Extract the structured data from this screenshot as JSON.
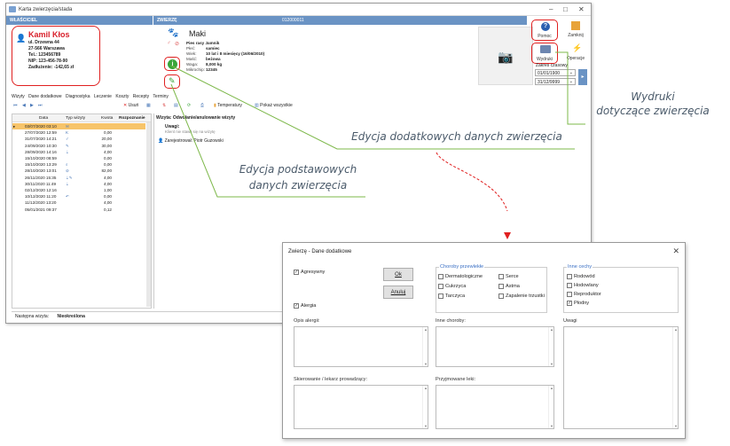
{
  "window": {
    "title": "Karta zwierzęcia/stada"
  },
  "owner_header": "WŁAŚCICIEL",
  "animal_header": "ZWIERZĘ",
  "animal_id": "012000011",
  "owner": {
    "name": "Kamil Kłos",
    "street": "ul. Drzewna 44",
    "city": "27-566  Warszawa",
    "phone": "Tel.: 123456789",
    "nip": "NIP: 123-456-78-90",
    "debt": "Zadłużenie: -142,65 zł"
  },
  "animal": {
    "name": "Maki",
    "rows": [
      {
        "k": "Pies rasy",
        "v": "Jamnik"
      },
      {
        "k": "Płeć:",
        "v": "samiec"
      },
      {
        "k": "Wiek:",
        "v": "10 lat i 8 miesięcy (16/06/2010)"
      },
      {
        "k": "Maść:",
        "v": "beżowa"
      },
      {
        "k": "Waga:",
        "v": "8,000 kg"
      },
      {
        "k": "Mikrochip:",
        "v": "12345"
      }
    ]
  },
  "right_buttons": {
    "help": "Pomoc",
    "close": "Zamknij",
    "prints": "Wydruki",
    "operations": "Operacje"
  },
  "date_range": {
    "label": "Zakres czasowy",
    "from": "01/01/1900",
    "to": "31/12/9999"
  },
  "tabs": [
    "Wizyty",
    "Dane dodatkowe",
    "Diagnostyka",
    "Leczenie",
    "Koszty",
    "Recepty",
    "Terminy"
  ],
  "toolbar": {
    "delete": "Usuń",
    "settle": "Rozpoznanie",
    "temperature": "Temperatury",
    "show_all": "Pokaż wszystkie"
  },
  "grid": {
    "cols": [
      "Data",
      "Typ wizyty",
      "Kwota"
    ],
    "rows": [
      {
        "date": "03/07/2020 03:10",
        "amount": ""
      },
      {
        "date": "27/07/2020 12:59",
        "amount": "0,00"
      },
      {
        "date": "31/07/2020 14:21",
        "amount": "20,00"
      },
      {
        "date": "24/09/2020 10:30",
        "amount": "30,00"
      },
      {
        "date": "28/09/2020 14:16",
        "amount": "4,00"
      },
      {
        "date": "15/10/2020 08:59",
        "amount": "0,00"
      },
      {
        "date": "15/10/2020 13:29",
        "amount": "0,00"
      },
      {
        "date": "28/10/2020 13:01",
        "amount": "82,00"
      },
      {
        "date": "26/11/2020 15:35",
        "amount": "4,00"
      },
      {
        "date": "30/11/2020 11:49",
        "amount": "4,00"
      },
      {
        "date": "02/12/2020 12:16",
        "amount": "1,00"
      },
      {
        "date": "10/12/2020 11:20",
        "amount": "0,00"
      },
      {
        "date": "11/12/2020 13:20",
        "amount": "4,00"
      },
      {
        "date": "05/01/2021 09:37",
        "amount": "0,12"
      }
    ]
  },
  "visit": {
    "title": "Wizyta: Odwołanie/anulowanie wizyty",
    "notes_label": "Uwagi:",
    "notes_text": "Klient nie stawił się na wizytę",
    "registered": "Zarejestrował: Piotr Guzowski"
  },
  "status": {
    "label": "Następna wizyta:",
    "value": "Nieokreślona"
  },
  "callouts": {
    "prints": "Wydruki\ndotyczące zwierzęcia",
    "additional": "Edycja dodatkowych danych zwierzęcia",
    "basic": "Edycja podstawowych\ndanych zwierzęcia"
  },
  "dialog": {
    "title": "Zwierzę - Dane dodatkowe",
    "aggressive": "Agresywny",
    "ok": "Ok",
    "cancel": "Anuluj",
    "allergy": "Alergia",
    "chronic_label": "Choroby przewlekłe",
    "chronic": [
      "Dermatologiczne",
      "Serce",
      "Cukrzyca",
      "Astma",
      "Tarczyca",
      "Zapalenie trzustki"
    ],
    "other_label": "Inne cechy",
    "other": [
      "Rodowód",
      "Hodowlany",
      "Reproduktor",
      "Płodny"
    ],
    "allergy_desc": "Opis alergii:",
    "other_diseases": "Inne choroby:",
    "notes": "Uwagi",
    "referral": "Skierowanie / lekarz prowadzący:",
    "meds": "Przyjmowane leki:"
  },
  "colors": {
    "accent": "#6a93c4",
    "highlight": "#e02020",
    "callout_line": "#7db84a"
  }
}
